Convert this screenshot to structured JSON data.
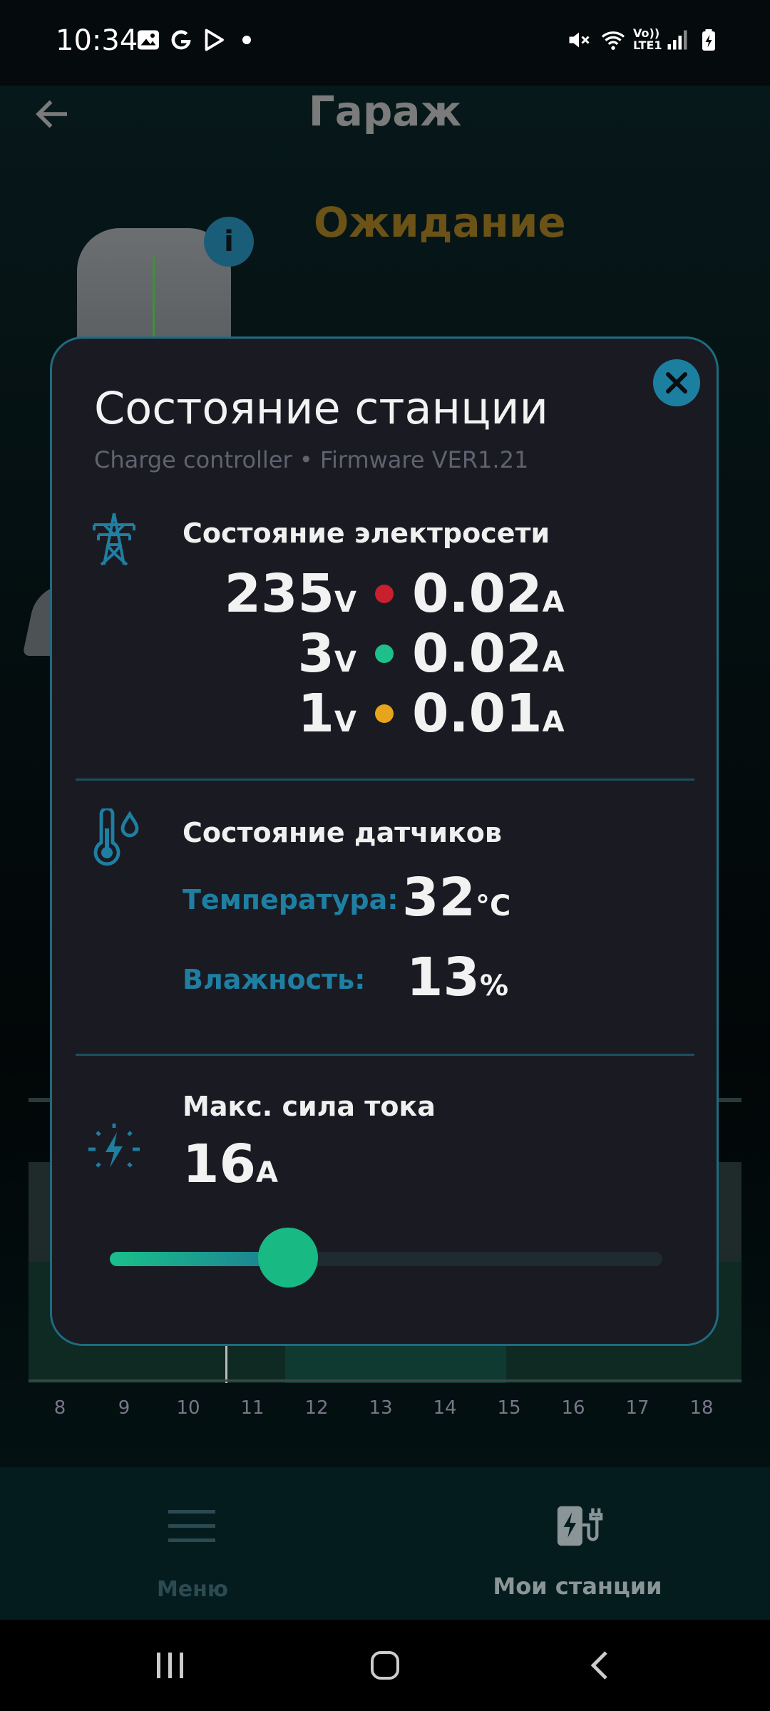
{
  "status_bar": {
    "time": "10:34",
    "icons": [
      "image-icon",
      "google-icon",
      "play-store-icon",
      "dot-icon",
      "mute-icon",
      "wifi-icon",
      "volte-icon",
      "signal-icon",
      "battery-charging-icon"
    ],
    "volte_text": "Vo)) LTE1"
  },
  "header": {
    "title": "Гараж",
    "back_icon": "arrow-left-icon"
  },
  "background": {
    "state": "Ожидание",
    "info_icon": "i"
  },
  "chart_ticks": [
    "8",
    "9",
    "10",
    "11",
    "12",
    "13",
    "14",
    "15",
    "16",
    "17",
    "18"
  ],
  "modal": {
    "title": "Состояние станции",
    "subtitle": "Charge controller • Firmware VER1.21",
    "grid": {
      "title": "Состояние электросети",
      "icon": "power-tower-icon",
      "phases": [
        {
          "voltage": "235",
          "voltage_unit": "V",
          "current": "0.02",
          "current_unit": "A",
          "color": "#c8202e"
        },
        {
          "voltage": "3",
          "voltage_unit": "V",
          "current": "0.02",
          "current_unit": "A",
          "color": "#1fbf8c"
        },
        {
          "voltage": "1",
          "voltage_unit": "V",
          "current": "0.01",
          "current_unit": "A",
          "color": "#e7a51b"
        }
      ]
    },
    "sensors": {
      "title": "Состояние датчиков",
      "icon": "thermometer-drop-icon",
      "temperature_label": "Температура:",
      "temperature_value": "32",
      "temperature_unit": "°C",
      "humidity_label": "Влажность:",
      "humidity_value": "13",
      "humidity_unit": "%"
    },
    "max_current": {
      "title": "Макс. сила тока",
      "icon": "lightning-icon",
      "value": "16",
      "unit": "A",
      "slider_fraction": 0.25
    }
  },
  "bottom_nav": {
    "menu_label": "Меню",
    "stations_label": "Мои станции"
  },
  "colors": {
    "accent": "#1d7fa0",
    "green": "#18b983",
    "modal_bg": "#1a1b22"
  }
}
